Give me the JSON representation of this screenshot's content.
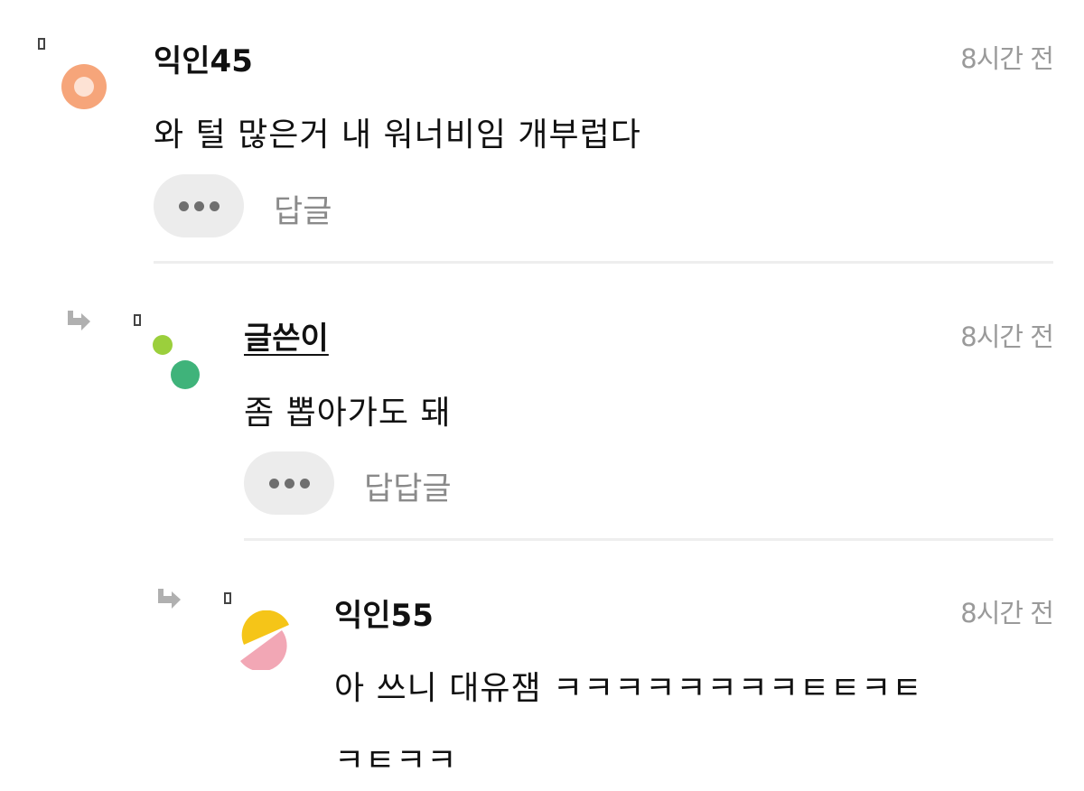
{
  "comments": [
    {
      "nickname": "익인45",
      "time": "8시간 전",
      "text": "와 털 많은거 내 워너비임 개부럽다",
      "reply_label": "답글",
      "is_author": false
    },
    {
      "nickname": "글쓴이",
      "time": "8시간 전",
      "text": "좀 뽑아가도 돼",
      "reply_label": "답답글",
      "is_author": true
    },
    {
      "nickname": "익인55",
      "time": "8시간 전",
      "text_line1": "아 쓰니 대유잼 ㅋㅋㅋㅋㅋㅋㅋㅋㅌㅌㅋㅌ",
      "text_line2": "ㅋㅌㅋㅋ",
      "is_author": false
    }
  ],
  "colors": {
    "avatar1_outer": "#f6a57a",
    "avatar1_inner": "#fde2d4",
    "avatar2_small": "#9bcf3c",
    "avatar2_big": "#3fb37a",
    "avatar3_top": "#f5c518",
    "avatar3_bottom": "#f2a7b5",
    "reply_arrow": "#b0b0b0",
    "time_text": "#9a9a9a"
  },
  "icons": [
    "reply-arrow-icon",
    "more-options-icon"
  ]
}
